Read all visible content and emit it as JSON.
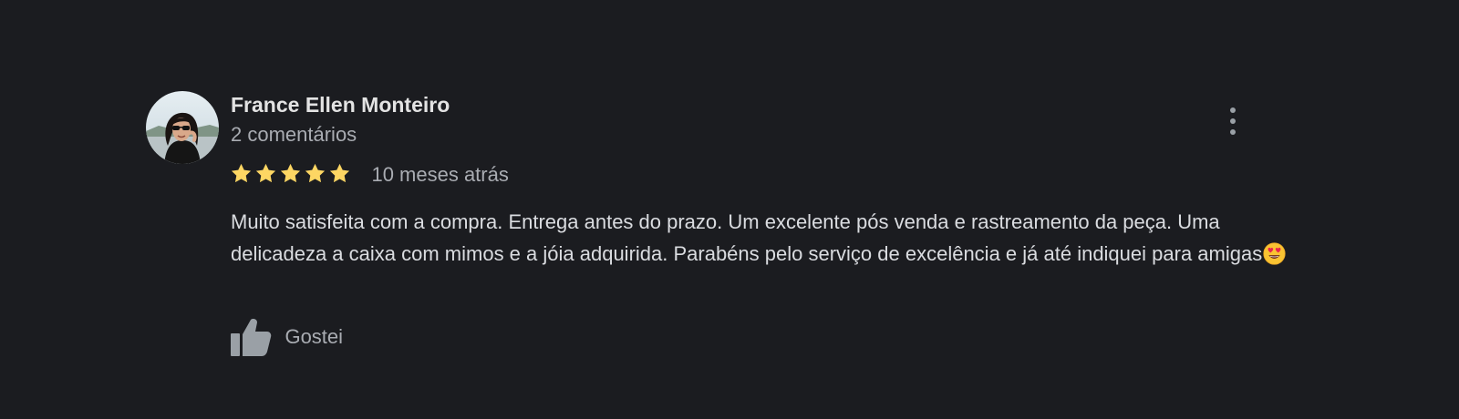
{
  "review": {
    "author_name": "France Ellen Monteiro",
    "author_review_count": "2 comentários",
    "rating": 5,
    "max_rating": 5,
    "date": "10 meses atrás",
    "text": "Muito satisfeita com a compra.  Entrega antes do prazo. Um excelente pós venda e rastreamento da peça. Uma delicadeza a caixa com mimos e a jóia adquirida. Parabéns pelo serviço de excelência e já até indiquei para amigas",
    "like_label": "Gostei",
    "colors": {
      "background": "#1b1c20",
      "star": "#fdd663",
      "name": "#e3e3e3",
      "muted": "#a9acb2",
      "body": "#dadce0",
      "icon": "#9aa0a6"
    },
    "icons": {
      "avatar": "profile-photo",
      "more": "more-vert-icon",
      "star": "star-icon",
      "emoji": "heart-eyes-emoji-icon",
      "like": "thumbs-up-icon"
    }
  }
}
